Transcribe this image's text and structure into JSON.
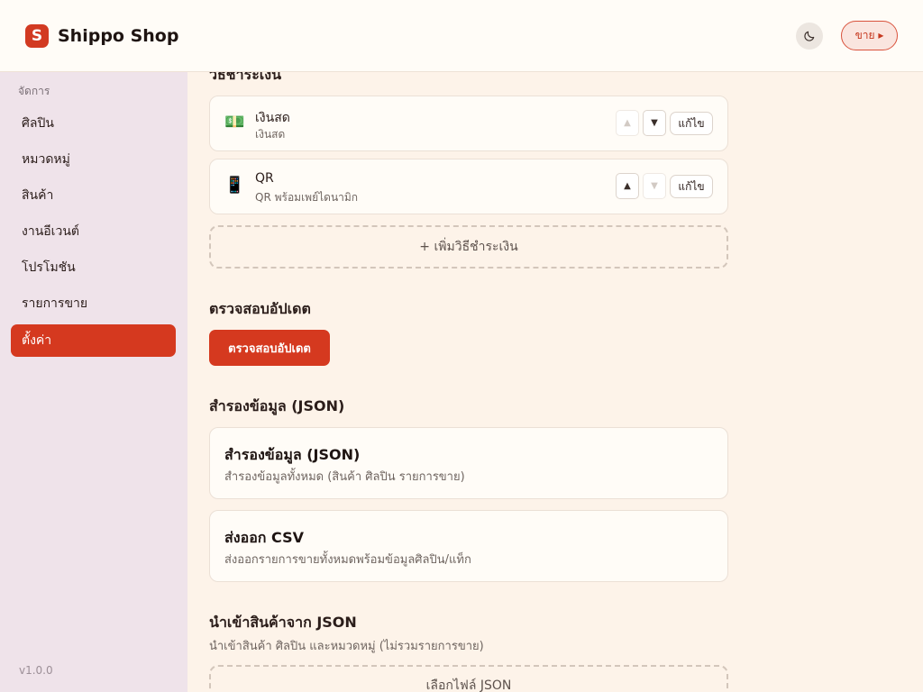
{
  "header": {
    "logo_letter": "S",
    "app_title": "Shippo Shop",
    "theme_icon": "moon-icon",
    "sell_label": "ขาย ▸"
  },
  "sidebar": {
    "section_label": "จัดการ",
    "items": [
      {
        "label": "ศิลปิน",
        "active": false
      },
      {
        "label": "หมวดหมู่",
        "active": false
      },
      {
        "label": "สินค้า",
        "active": false
      },
      {
        "label": "งานอีเวนต์",
        "active": false
      },
      {
        "label": "โปรโมชัน",
        "active": false
      },
      {
        "label": "รายการขาย",
        "active": false
      },
      {
        "label": "ตั้งค่า",
        "active": true
      }
    ],
    "version": "v1.0.0"
  },
  "main": {
    "payment_heading": "วิธีชำระเงิน",
    "payment_methods": [
      {
        "icon": "💵",
        "icon_name": "cash-icon",
        "name": "เงินสด",
        "desc": "เงินสด",
        "up_disabled": true,
        "down_disabled": false,
        "edit_label": "แก้ไข"
      },
      {
        "icon": "📱",
        "icon_name": "phone-icon",
        "name": "QR",
        "desc": "QR พร้อมเพย์ไดนามิก",
        "up_disabled": false,
        "down_disabled": true,
        "edit_label": "แก้ไข"
      }
    ],
    "up_arrow": "▲",
    "down_arrow": "▼",
    "add_payment_label": "+ เพิ่มวิธีชำระเงิน",
    "update_heading": "ตรวจสอบอัปเดต",
    "update_button": "ตรวจสอบอัปเดต",
    "backup_heading": "สำรองข้อมูล (JSON)",
    "backup_card": {
      "title": "สำรองข้อมูล (JSON)",
      "desc": "สำรองข้อมูลทั้งหมด (สินค้า ศิลปิน รายการขาย)"
    },
    "export_card": {
      "title": "ส่งออก CSV",
      "desc": "ส่งออกรายการขายทั้งหมดพร้อมข้อมูลศิลปิน/แท็ก"
    },
    "import_heading": "นำเข้าสินค้าจาก JSON",
    "import_sub": "นำเข้าสินค้า ศิลปิน และหมวดหมู่ (ไม่รวมรายการขาย)",
    "choose_file_label": "เลือกไฟล์ JSON"
  },
  "colors": {
    "accent": "#d5391f",
    "sidebar_bg": "#efe3ea",
    "main_bg": "#fdf3e9",
    "card_bg": "#fffcf7"
  }
}
